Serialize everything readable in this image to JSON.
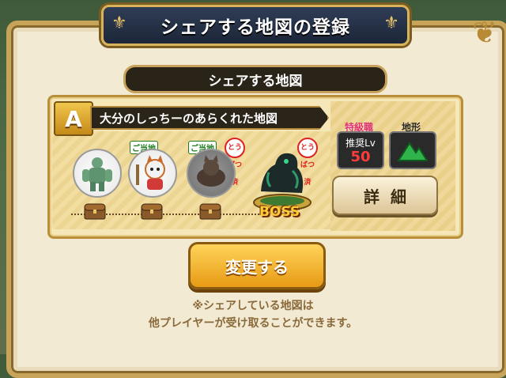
{
  "window": {
    "title": "シェアする地図の登録"
  },
  "section": {
    "label": "シェアする地図"
  },
  "map": {
    "rank": "A",
    "name": "大分のしっちーのあらくれた地図",
    "difficulty_label": "特級職",
    "level_label": "推奨Lv",
    "level_value": "50",
    "terrain_label": "地形",
    "terrain_icon": "mountain-icon",
    "monsters": [
      {
        "name": "stone-golem",
        "tag": "",
        "toubatsu": false
      },
      {
        "name": "cat-warrior",
        "tag": "ご当地",
        "toubatsu": false
      },
      {
        "name": "dark-cat",
        "tag": "ご当地",
        "toubatsu": true
      },
      {
        "name": "boss-dragon",
        "tag": "",
        "toubatsu": true
      }
    ],
    "toubatsu_label": "とうばつ済",
    "boss_label": "BOSS",
    "detail_button": "詳細"
  },
  "actions": {
    "change_button": "変更する"
  },
  "notes": {
    "line1": "※シェアしている地図は",
    "line2": "他プレイヤーが受け取ることができます。"
  },
  "colors": {
    "accent": "#e79a14",
    "plate": "#2a2418",
    "frame": "#c8a35a"
  }
}
